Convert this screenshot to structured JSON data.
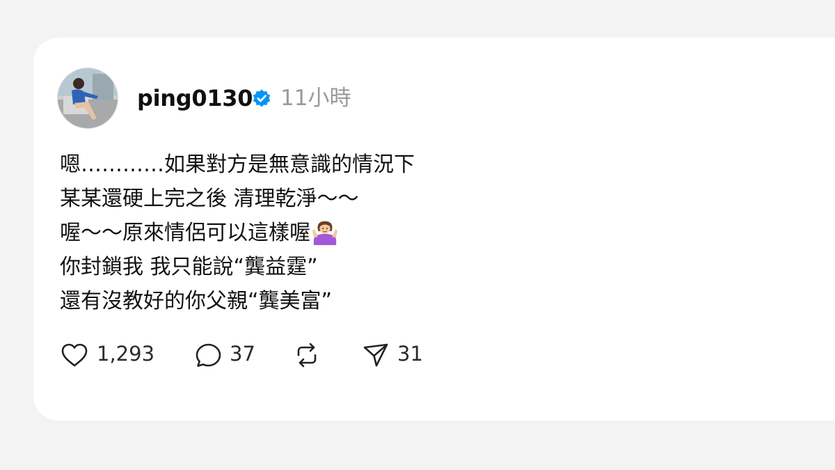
{
  "post": {
    "username": "ping0130",
    "verified": true,
    "timestamp": "11小時",
    "lines": [
      "嗯…………如果對方是無意識的情況下",
      "某某還硬上完之後 清理乾淨～～",
      "喔～～原來情侶可以這樣喔",
      "你封鎖我 我只能說“龔益霆”",
      "還有沒教好的你父親“龔美富”"
    ],
    "emoji": "person-shrugging"
  },
  "actions": {
    "like_count": "1,293",
    "comment_count": "37",
    "share_count": "31"
  },
  "colors": {
    "page_background": "#f3f3f3",
    "card_background": "#ffffff",
    "verified_badge": "#0095f6",
    "muted_text": "#9a9a9a"
  },
  "icons": [
    "heart-icon",
    "comment-icon",
    "repost-icon",
    "send-icon",
    "verified-badge-icon"
  ]
}
